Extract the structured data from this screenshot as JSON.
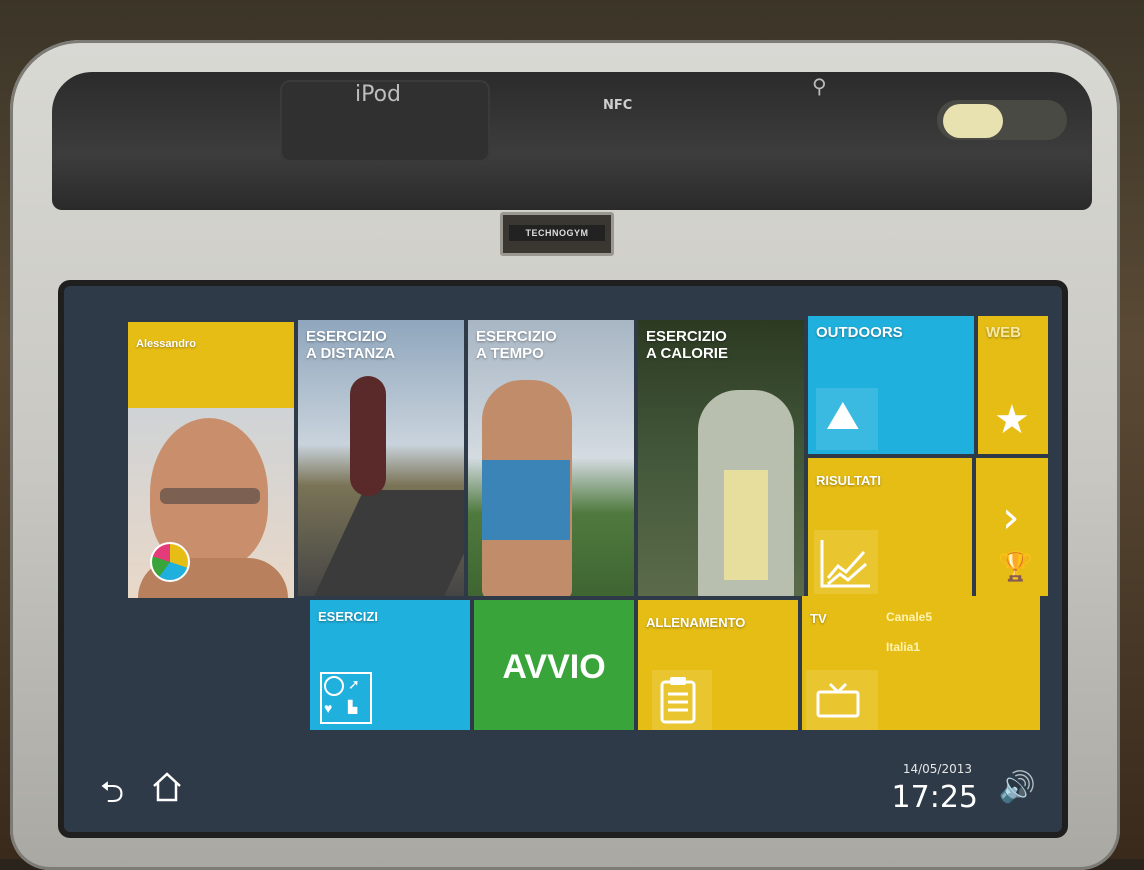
{
  "device": {
    "dock_label": "iPod",
    "nfc_label": "NFC",
    "brand": "TECHNOGYM"
  },
  "tiles": {
    "profile": {
      "name": "Alessandro"
    },
    "distance": {
      "title": "ESERCIZIO\nA DISTANZA"
    },
    "time": {
      "title": "ESERCIZIO\nA TEMPO"
    },
    "calories": {
      "title": "ESERCIZIO\nA CALORIE"
    },
    "outdoors": {
      "title": "OUTDOORS"
    },
    "web": {
      "title": "WEB"
    },
    "results": {
      "title": "RISULTATI"
    },
    "exercises": {
      "title": "ESERCIZI"
    },
    "start": {
      "label": "AVVIO"
    },
    "training": {
      "title": "ALLENAMENTO"
    },
    "tv": {
      "title": "TV",
      "channels": [
        "Canale5",
        "Italia1"
      ]
    }
  },
  "status_bar": {
    "date": "14/05/2013",
    "time": "17:25"
  },
  "colors": {
    "yellow": "#e6bd14",
    "cyan": "#1fb0dd",
    "green": "#39a43a"
  },
  "icons": [
    "back-icon",
    "home-icon",
    "volume-icon",
    "star-icon",
    "trophy-icon",
    "chart-icon",
    "clipboard-icon",
    "tv-icon",
    "road-icon",
    "exercise-grid-icon",
    "pie-icon"
  ]
}
